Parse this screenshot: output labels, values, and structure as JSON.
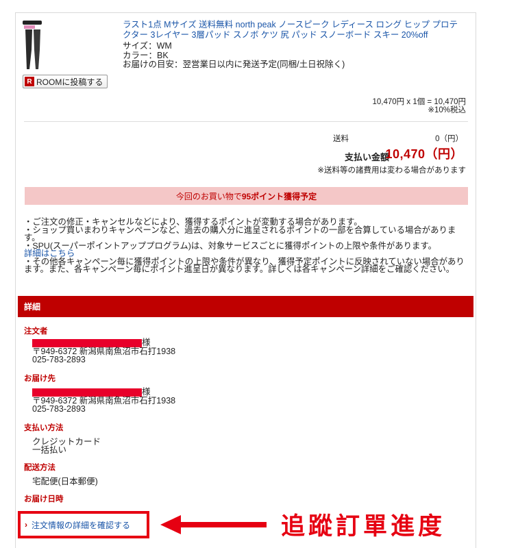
{
  "product": {
    "title": "ラスト1点 Mサイズ 送料無料 north peak ノースピーク レディース ロング ヒップ プロテクター 3レイヤー 3層パッド スノボ ケツ 尻 パッド スノーボード スキー 20%off",
    "size": "サイズ：WM",
    "color": "カラー：BK",
    "delivery_estimate": "お届けの目安：翌営業日以内に発送予定(同梱/土日祝除く)",
    "room_button": "ROOMに投稿する",
    "room_icon_letter": "R",
    "price_calc": "10,470円 x 1個 = 10,470円",
    "tax_note": "※10%税込"
  },
  "totals": {
    "shipping_label": "送料",
    "shipping_value": "0（円）",
    "payment_label": "支払い金額",
    "payment_value": "10,470（円）",
    "note": "※送料等の諸費用は変わる場合があります"
  },
  "points": {
    "prefix": "今回のお買い物で",
    "highlight": "95ポイント獲得予定"
  },
  "notes": {
    "line1": "・ご注文の修正・キャンセルなどにより、獲得するポイントが変動する場合があります。",
    "line2": "・ショップ買いまわりキャンペーンなど、過去の購入分に進呈されるポイントの一部を合算している場合があります。",
    "line3": "・SPU(スーパーポイントアッププログラム)は、対象サービスごとに獲得ポイントの上限や条件があります。",
    "link": "詳細はこちら",
    "line4": "・その他各キャンペーン毎に獲得ポイントの上限や条件が異なり、獲得予定ポイントに反映されていない場合があります。また、各キャンペーン毎にポイント進呈日が異なります。詳しくは各キャンペーン詳細をご確認ください。"
  },
  "details": {
    "heading": "詳細",
    "orderer_title": "注文者",
    "orderer_suffix": "様",
    "orderer_address": "〒949-6372 新潟県南魚沼市石打1938",
    "orderer_phone": "025-783-2893",
    "recipient_title": "お届け先",
    "recipient_suffix": "様",
    "recipient_address": "〒949-6372 新潟県南魚沼市石打1938",
    "recipient_phone": "025-783-2893",
    "payment_title": "支払い方法",
    "payment_method": "クレジットカード",
    "payment_plan": "一括払い",
    "delivery_title": "配送方法",
    "delivery_method": "宅配便(日本郵便)",
    "date_title": "お届け日時"
  },
  "confirm_link": "注文情報の詳細を確認する",
  "annotation": "追蹤訂單進度",
  "colors": {
    "brand_red": "#bf0000",
    "link_blue": "#1a55a8",
    "points_bg": "#f4c7c7",
    "annotation_red": "#e60012"
  }
}
